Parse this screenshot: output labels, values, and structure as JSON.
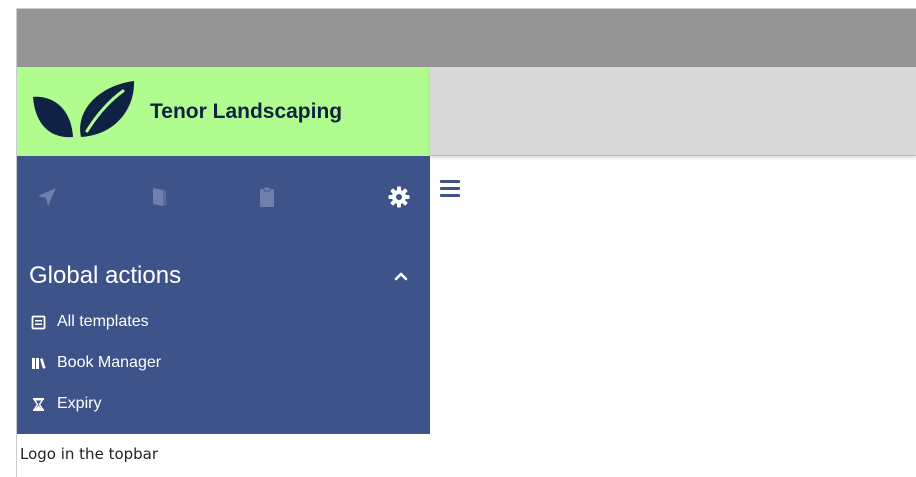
{
  "logo": {
    "text": "Tenor Landscaping",
    "icon": "leaf-logo-icon",
    "leaf_color": "#102244",
    "background": "#b1fc8e"
  },
  "sidebar": {
    "background": "#3e5389",
    "tabs": [
      {
        "icon": "navigation-arrow-icon",
        "active": false
      },
      {
        "icon": "book-icon",
        "active": false
      },
      {
        "icon": "clipboard-icon",
        "active": false
      },
      {
        "icon": "gear-icon",
        "active": true
      }
    ],
    "section": {
      "title": "Global actions",
      "toggle_icon": "chevron-up-icon",
      "items": [
        {
          "label": "All templates",
          "icon": "template-list-icon"
        },
        {
          "label": "Book Manager",
          "icon": "books-icon"
        },
        {
          "label": "Expiry",
          "icon": "hourglass-icon"
        }
      ]
    }
  },
  "topbar": {
    "menu_icon": "hamburger-menu-icon",
    "colors": {
      "grey_bar": "#959595",
      "header": "#d9d9d9"
    }
  },
  "caption": "Logo in the topbar"
}
